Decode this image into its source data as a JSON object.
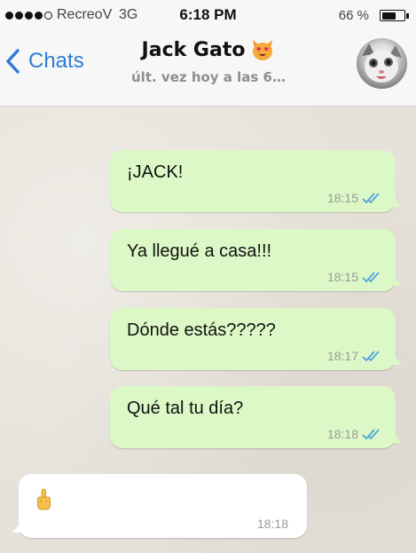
{
  "status_bar": {
    "carrier": "RecreoV",
    "network": "3G",
    "time": "6:18 PM",
    "battery_percent": "66 %",
    "battery_level": 0.66,
    "signal_strength": 4
  },
  "header": {
    "back_label": "Chats",
    "contact_name": "Jack Gato",
    "contact_emoji_icon": "heart-eyes-cat-icon",
    "last_seen": "últ. vez hoy a las 6…"
  },
  "messages": [
    {
      "direction": "out",
      "text": "¡JACK!",
      "time": "18:15",
      "status_icon": "double-check-icon"
    },
    {
      "direction": "out",
      "text": "Ya llegué a casa!!!",
      "time": "18:15",
      "status_icon": "double-check-icon"
    },
    {
      "direction": "out",
      "text": "Dónde estás?????",
      "time": "18:17",
      "status_icon": "double-check-icon"
    },
    {
      "direction": "out",
      "text": "Qué tal tu día?",
      "time": "18:18",
      "status_icon": "double-check-icon"
    },
    {
      "direction": "in",
      "text": "",
      "emoji_icon": "middle-finger-icon",
      "time": "18:18"
    }
  ],
  "colors": {
    "accent": "#2e7bd6",
    "outgoing_bubble": "#dcf8c6",
    "incoming_bubble": "#ffffff",
    "read_check": "#4fa3e0"
  }
}
